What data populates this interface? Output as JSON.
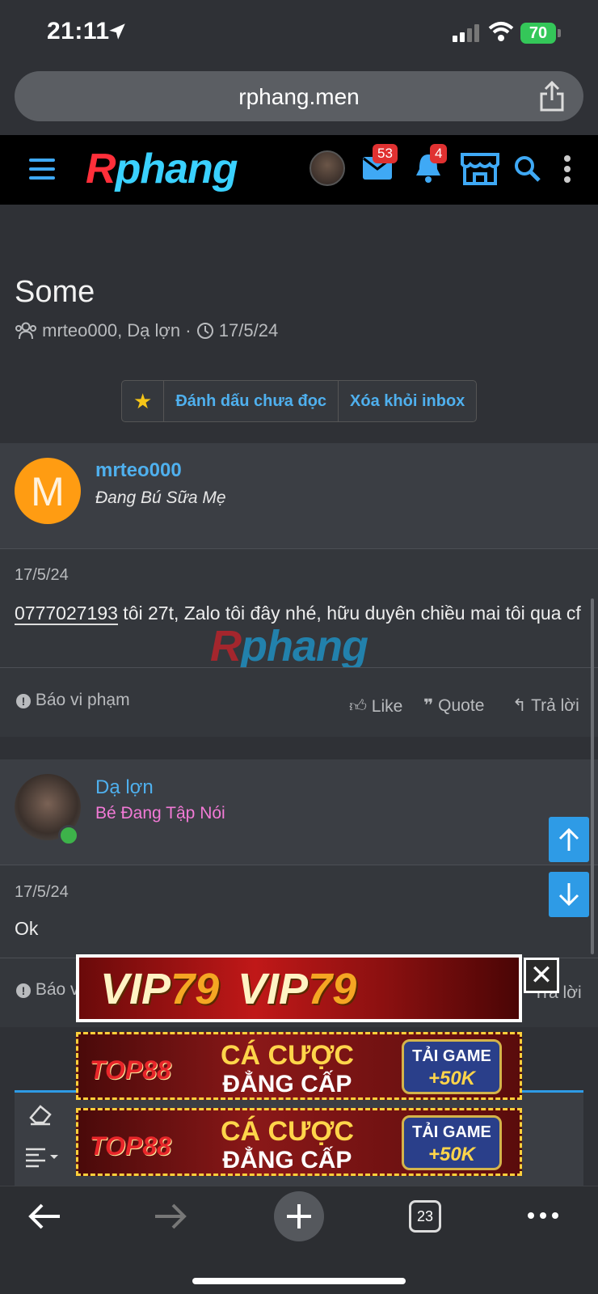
{
  "status_bar": {
    "time": "21:11",
    "battery": "70"
  },
  "browser": {
    "url": "rphang.men",
    "tab_count": "23"
  },
  "site": {
    "logo_r": "R",
    "logo_rest": "phang",
    "mail_badge": "53",
    "alert_badge": "4"
  },
  "conversation": {
    "title": "Some",
    "participants": "mrteo000, Dạ lợn",
    "date": "17/5/24",
    "actions": {
      "mark_unread": "Đánh dấu chưa đọc",
      "leave": "Xóa khỏi inbox"
    }
  },
  "messages": [
    {
      "avatar_letter": "M",
      "username": "mrteo000",
      "user_title": "Đang Bú Sữa Mẹ",
      "date": "17/5/24",
      "phone": "0777027193",
      "content_rest": " tôi 27t, Zalo tôi đây nhé, hữu duyên chiều mai tôi qua cf",
      "report": "Báo vi phạm",
      "like": "Like",
      "quote": "Quote",
      "reply": "Trả lời"
    },
    {
      "username": "Dạ lợn",
      "user_title": "Bé Đang Tập Nói",
      "date": "17/5/24",
      "content": "Ok",
      "report_partial": "Báo v",
      "reply": "Trả lời"
    }
  ],
  "watermark": {
    "r": "R",
    "rest": "phang"
  },
  "ads": {
    "vip_label_a": "VIP",
    "vip_label_b": "79",
    "top88": "TOP88",
    "cacuoc": "CÁ CƯỢC",
    "dangcap": "ĐẲNG CẤP",
    "taigame": "TẢI GAME",
    "bonus": "+50K",
    "close": "✕"
  },
  "colors": {
    "accent": "#4fb0ee",
    "orange_avatar": "#ff9c12",
    "pink_title": "#f27ad6",
    "online": "#3db34a"
  }
}
